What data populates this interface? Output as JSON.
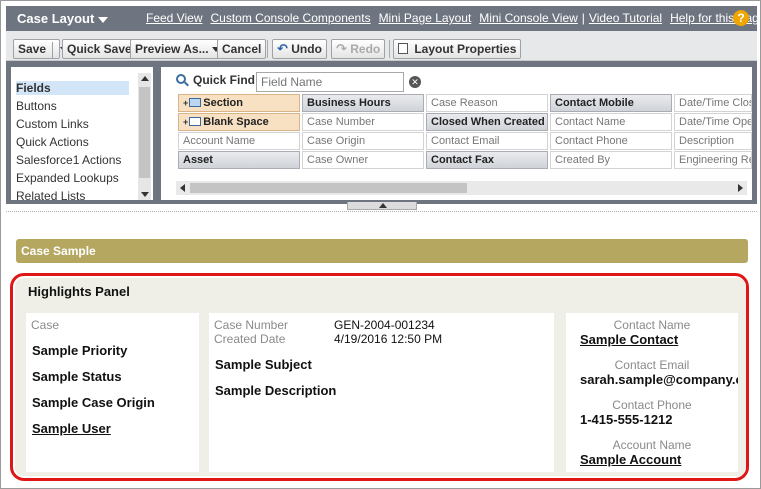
{
  "header": {
    "title": "Case Layout",
    "links": [
      "Feed View",
      "Custom Console Components",
      "Mini Page Layout",
      "Mini Console View"
    ],
    "links2": [
      "Video Tutorial",
      "Help for this Page"
    ],
    "help_icon": "?"
  },
  "toolbar": {
    "save": "Save",
    "quick_save": "Quick Save",
    "preview": "Preview As...",
    "cancel": "Cancel",
    "undo": "Undo",
    "redo": "Redo",
    "layout_properties": "Layout Properties"
  },
  "palette": {
    "categories": [
      "Fields",
      "Buttons",
      "Custom Links",
      "Quick Actions",
      "Salesforce1 Actions",
      "Expanded Lookups",
      "Related Lists"
    ],
    "selected_category": "Fields",
    "quick_find_label": "Quick Find",
    "quick_find_placeholder": "Field Name",
    "rows": [
      [
        "Section",
        "Business Hours",
        "Case Reason",
        "Contact Mobile",
        "Date/Time Closed"
      ],
      [
        "Blank Space",
        "Case Number",
        "Closed When Created",
        "Contact Name",
        "Date/Time Opened"
      ],
      [
        "Account Name",
        "Case Origin",
        "Contact Email",
        "Contact Phone",
        "Description"
      ],
      [
        "Asset",
        "Case Owner",
        "Contact Fax",
        "Created By",
        "Engineering Req"
      ]
    ]
  },
  "layout": {
    "section_title": "Case Sample",
    "highlights_title": "Highlights Panel",
    "col1": {
      "header": "Case",
      "items": [
        "Sample Priority",
        "Sample Status",
        "Sample Case Origin",
        "Sample User"
      ]
    },
    "col2": {
      "case_number_label": "Case Number",
      "case_number_value": "GEN-2004-001234",
      "created_date_label": "Created Date",
      "created_date_value": "4/19/2016 12:50 PM",
      "subject": "Sample Subject",
      "description": "Sample Description"
    },
    "col3": {
      "contact_name_label": "Contact Name",
      "contact_name_value": "Sample Contact",
      "contact_email_label": "Contact Email",
      "contact_email_value": "sarah.sample@company.com",
      "contact_phone_label": "Contact Phone",
      "contact_phone_value": "1-415-555-1212",
      "account_name_label": "Account Name",
      "account_name_value": "Sample Account"
    }
  },
  "colors": {
    "header_bg": "#6f7580",
    "section_bar": "#b5a660",
    "highlight_border": "#e01515",
    "selected_item": "#d2e6f7"
  }
}
